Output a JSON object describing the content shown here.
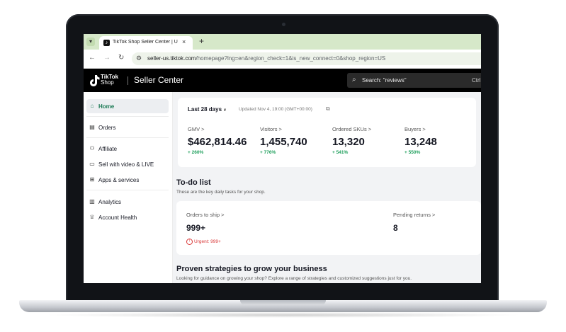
{
  "browser": {
    "tab_title": "TikTok Shop Seller Center | Unit",
    "tab_close": "×",
    "new_tab": "+",
    "url_host": "seller-us.tiktok.com",
    "url_path": "/homepage?lng=en&region_check=1&is_new_connect=0&shop_region=US"
  },
  "header": {
    "brand_top": "TikTok",
    "brand_bottom": "Shop",
    "title": "Seller Center",
    "search_placeholder": "Search: \"reviews\"",
    "search_shortcut": "Ctrl"
  },
  "sidebar": {
    "items": [
      {
        "label": "Home",
        "icon": "home-icon"
      },
      {
        "label": "Orders",
        "icon": "clipboard-icon"
      },
      {
        "label": "Affiliate",
        "icon": "people-icon"
      },
      {
        "label": "Sell with video & LIVE",
        "icon": "video-icon"
      },
      {
        "label": "Apps & services",
        "icon": "apps-icon"
      },
      {
        "label": "Analytics",
        "icon": "chart-icon"
      },
      {
        "label": "Account Health",
        "icon": "trophy-icon"
      }
    ]
  },
  "stats": {
    "period": "Last 28 days",
    "updated": "Updated Nov 4, 19:00 (GMT+00:00)",
    "metrics": [
      {
        "label": "GMV >",
        "value": "$462,814.46",
        "change": "+ 260%"
      },
      {
        "label": "Visitors >",
        "value": "1,455,740",
        "change": "+ 776%"
      },
      {
        "label": "Ordered SKUs >",
        "value": "13,320",
        "change": "+ 541%"
      },
      {
        "label": "Buyers >",
        "value": "13,248",
        "change": "+ 550%"
      }
    ]
  },
  "todo": {
    "title": "To-do list",
    "subtitle": "These are the key daily tasks for your shop.",
    "orders_label": "Orders to ship >",
    "orders_value": "999+",
    "urgent": "Urgent: 999+",
    "returns_label": "Pending returns >",
    "returns_value": "8"
  },
  "growth": {
    "title": "Proven strategies to grow your business",
    "subtitle": "Looking for guidance on growing your shop? Explore a range of strategies and customized suggestions just for you."
  },
  "colors": {
    "accent_green": "#1c7a55",
    "positive": "#1c9e5a",
    "urgent": "#d93636",
    "header_bg": "#000000",
    "tabbar_bg": "#d6e8c9"
  }
}
